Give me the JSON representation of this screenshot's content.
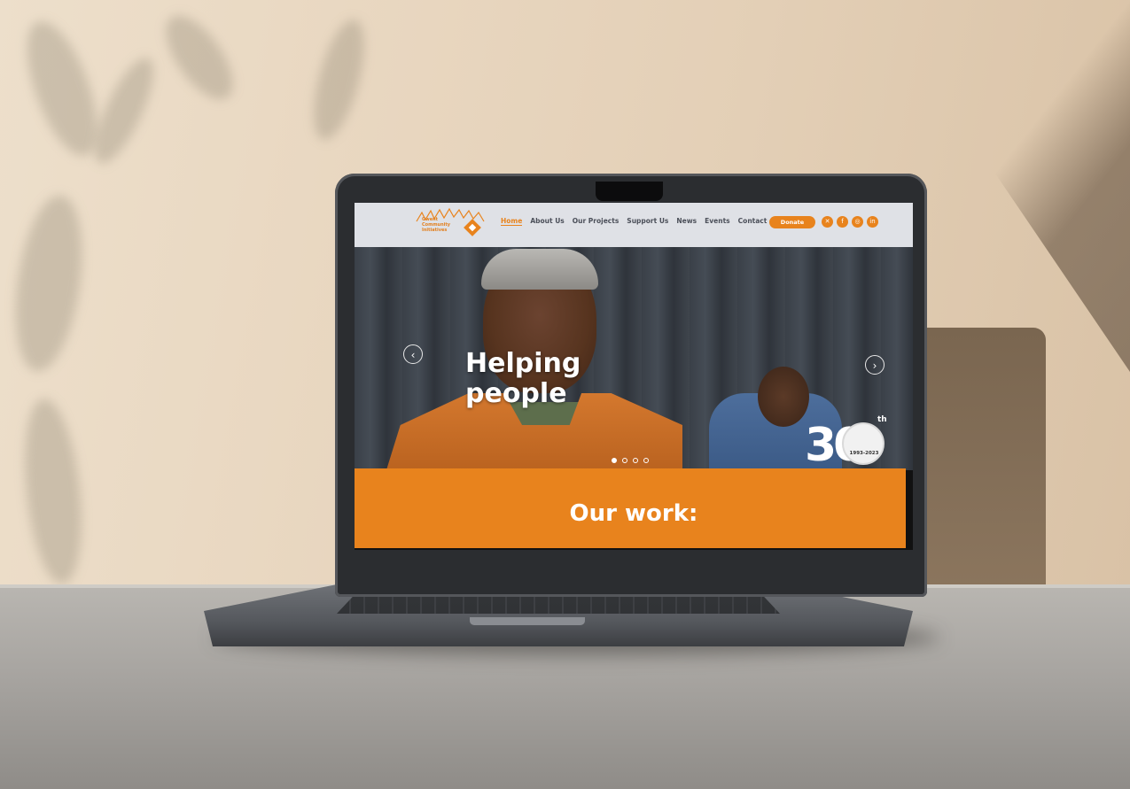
{
  "site": {
    "logo_text": "Gwent Community Initiatives",
    "nav": {
      "items": [
        {
          "label": "Home",
          "active": true
        },
        {
          "label": "About Us",
          "active": false
        },
        {
          "label": "Our Projects",
          "active": false
        },
        {
          "label": "Support Us",
          "active": false
        },
        {
          "label": "News",
          "active": false
        },
        {
          "label": "Events",
          "active": false
        },
        {
          "label": "Contact",
          "active": false
        }
      ],
      "donate_label": "Donate",
      "social_icons": [
        "x-icon",
        "facebook-icon",
        "instagram-icon",
        "linkedin-icon"
      ]
    },
    "hero": {
      "title_line1": "Helping",
      "title_line2": "people",
      "prev_arrow": "‹",
      "next_arrow": "›",
      "slide_count": 4,
      "active_slide": 1,
      "badge": {
        "number": "30",
        "suffix": "th",
        "years": "1993-2023"
      }
    },
    "section_title": "Our work:"
  },
  "colors": {
    "accent": "#e8831d",
    "nav_bg": "#dfe1e6",
    "nav_text": "#4b4f59"
  }
}
